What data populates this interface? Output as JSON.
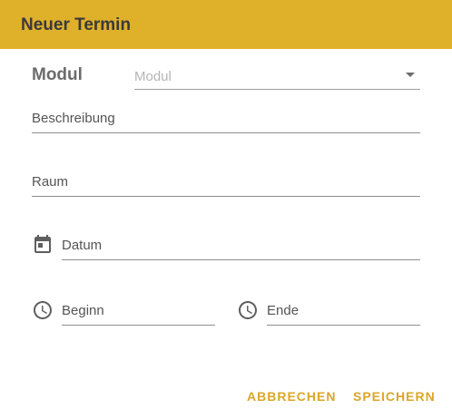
{
  "dialog": {
    "title": "Neuer Termin",
    "header_color": "#dfb02a",
    "accent_color": "#d9a72a"
  },
  "form": {
    "modul": {
      "label": "Modul",
      "placeholder": "Modul",
      "selected_value": ""
    },
    "beschreibung": {
      "label": "Beschreibung",
      "value": ""
    },
    "raum": {
      "label": "Raum",
      "value": ""
    },
    "datum": {
      "label": "Datum",
      "value": "",
      "icon": "calendar-icon"
    },
    "beginn": {
      "label": "Beginn",
      "value": "",
      "icon": "clock-icon"
    },
    "ende": {
      "label": "Ende",
      "value": "",
      "icon": "clock-icon"
    }
  },
  "actions": {
    "cancel_label": "ABBRECHEN",
    "save_label": "SPEICHERN"
  }
}
